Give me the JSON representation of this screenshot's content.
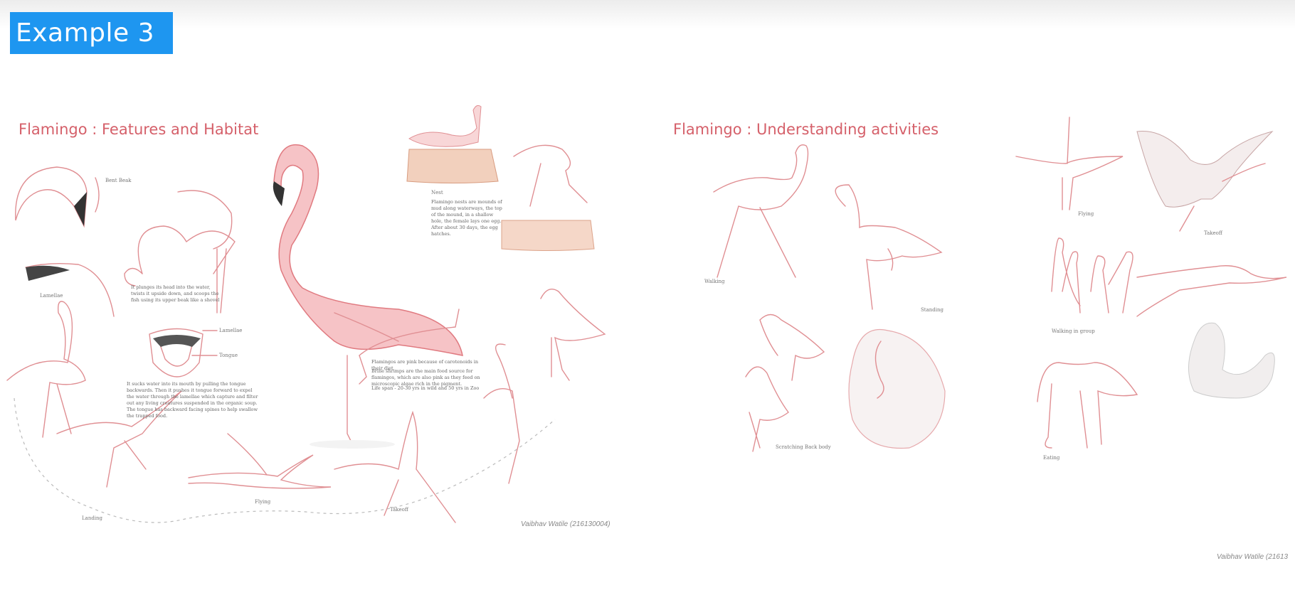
{
  "header": {
    "badge": "Example 3"
  },
  "left": {
    "title": "Flamingo : Features and Habitat",
    "labels": {
      "bent_beak": "Bent Beak",
      "lamellae": "Lamellae",
      "lamellae2": "Lamellae",
      "tongue": "Tongue",
      "nest": "Nest",
      "landing": "Landing",
      "flying": "Flying",
      "takeoff": "Takeoff"
    },
    "texts": {
      "feeding": "It plunges its head into the water, twists it upside down, and scoops the fish using its upper beak like a shovel",
      "tongue_text": "It sucks water into its mouth by pulling the tongue backwards. Then it pushes it tongue forward to expel the water through the lamellae which capture and filter out any living creatures suspended in the organic soup. The tongue has backward facing spines to help swallow the trapped food.",
      "nest_text": "Flamingo nests are mounds of mud along waterways, the top of the mound, in a shallow hole, the female lays one egg. After about 30 days, the egg hatches.",
      "pink_1": "Flamingos are pink because of carotenoids in their diet",
      "pink_2": "Brine shrimps are the main food source for flamingos, which are also pink as they feed on microscopic algae rich in the pigment.",
      "lifespan": "Life span - 20-30 yrs in wild and 50 yrs in Zoo"
    },
    "credit": "Vaibhav Watile (216130004)"
  },
  "right": {
    "title": "Flamingo : Understanding activities",
    "labels": {
      "walking": "Walking",
      "standing": "Standing",
      "flying": "Flying",
      "takeoff": "Takeoff",
      "walking_group": "Walking in group",
      "scratching": "Scratching Back body",
      "eating": "Eating"
    },
    "credit": "Vaibhav Watile (21613"
  },
  "colors": {
    "badge": "#1e96f0",
    "title": "#d5606a",
    "sketch": "#e08f93"
  }
}
